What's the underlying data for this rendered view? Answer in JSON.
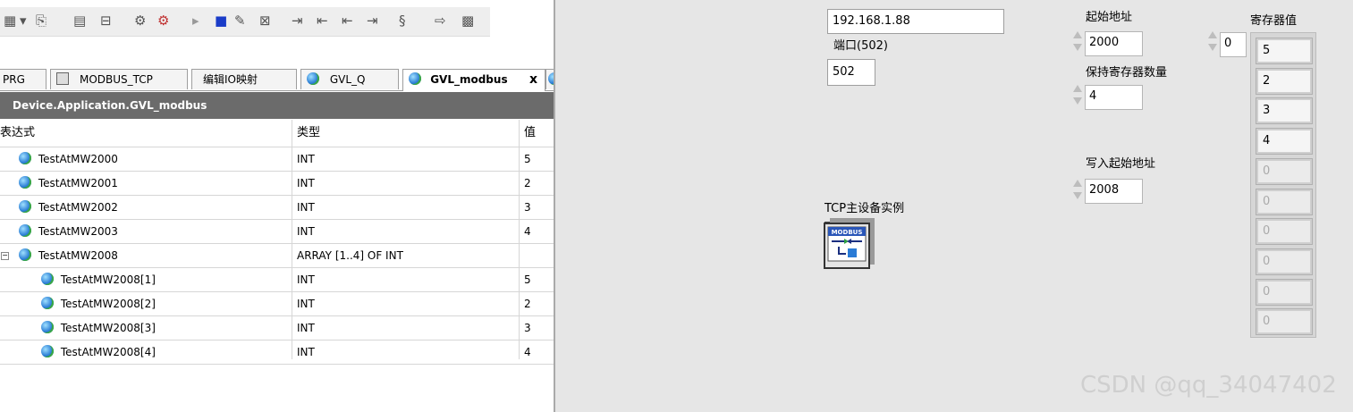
{
  "tabs": [
    {
      "label": "PRG",
      "active": false
    },
    {
      "label": "MODBUS_TCP",
      "active": false
    },
    {
      "label": "编辑IO映射",
      "active": false
    },
    {
      "label": "GVL_Q",
      "active": false
    },
    {
      "label": "GVL_modbus",
      "active": true
    }
  ],
  "tab_close": "x",
  "path": "Device.Application.GVL_modbus",
  "columns": {
    "expression": "表达式",
    "type": "类型",
    "value": "值"
  },
  "rows": [
    {
      "name": "TestAtMW2000",
      "type": "INT",
      "value": "5",
      "indent": 1
    },
    {
      "name": "TestAtMW2001",
      "type": "INT",
      "value": "2",
      "indent": 1
    },
    {
      "name": "TestAtMW2002",
      "type": "INT",
      "value": "3",
      "indent": 1
    },
    {
      "name": "TestAtMW2003",
      "type": "INT",
      "value": "4",
      "indent": 1
    },
    {
      "name": "TestAtMW2008",
      "type": "ARRAY [1..4] OF INT",
      "value": "",
      "indent": 1,
      "expander": "−"
    },
    {
      "name": "TestAtMW2008[1]",
      "type": "INT",
      "value": "5",
      "indent": 2
    },
    {
      "name": "TestAtMW2008[2]",
      "type": "INT",
      "value": "2",
      "indent": 2
    },
    {
      "name": "TestAtMW2008[3]",
      "type": "INT",
      "value": "3",
      "indent": 2
    },
    {
      "name": "TestAtMW2008[4]",
      "type": "INT",
      "value": "4",
      "indent": 2
    }
  ],
  "panel": {
    "address_value": "192.168.1.88",
    "port_label": "端口(502)",
    "port_value": "502",
    "start_addr_label": "起始地址",
    "start_addr_value": "2000",
    "hold_count_label": "保持寄存器数量",
    "hold_count_value": "4",
    "write_addr_label": "写入起始地址",
    "write_addr_value": "2008",
    "tcp_label": "TCP主设备实例",
    "modbus_text": "MODBUS",
    "reg_label": "寄存器值",
    "index_value": "0",
    "registers": [
      "5",
      "2",
      "3",
      "4",
      "0",
      "0",
      "0",
      "0",
      "0",
      "0"
    ]
  },
  "watermark": "CSDN @qq_34047402"
}
